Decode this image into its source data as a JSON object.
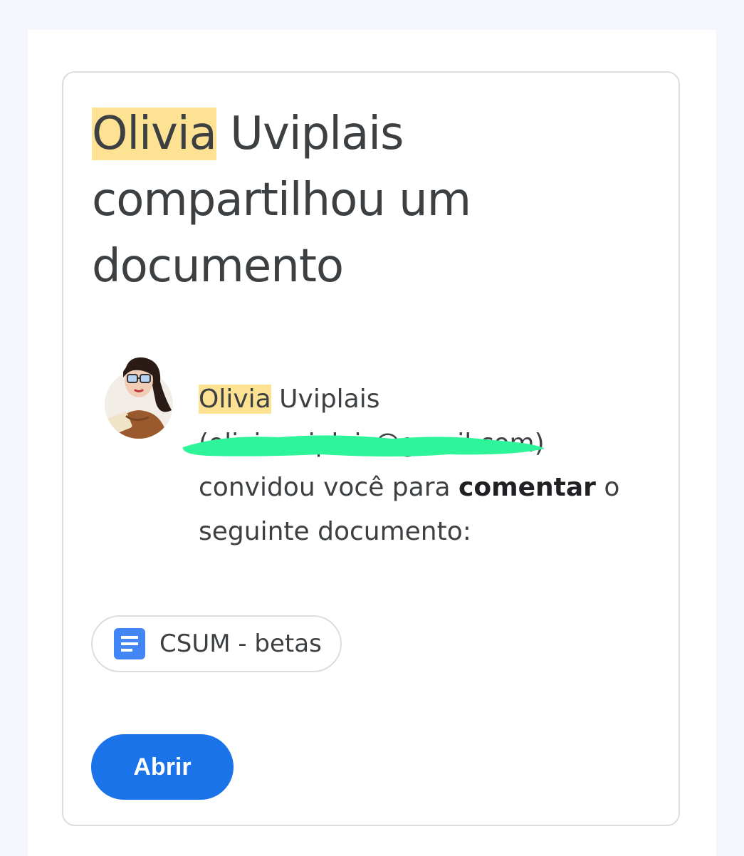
{
  "headline": {
    "name_first": "Olivia",
    "rest": " Uviplais compartilhou um documento"
  },
  "invite": {
    "name_first": "Olivia",
    "name_last": " Uviplais",
    "email_open": "(",
    "email_redacted": "oliviauviplais@gmail.com",
    "email_close": ")",
    "text_before_role": "convidou você para ",
    "role": "comentar",
    "text_after_role": " o seguinte documento:"
  },
  "document": {
    "icon": "google-docs-icon",
    "name": "CSUM - betas"
  },
  "actions": {
    "open_label": "Abrir"
  },
  "colors": {
    "highlight": "#fde293",
    "primary_button": "#1a73e8",
    "redaction": "#2ef59a",
    "doc_icon": "#4285f4"
  }
}
